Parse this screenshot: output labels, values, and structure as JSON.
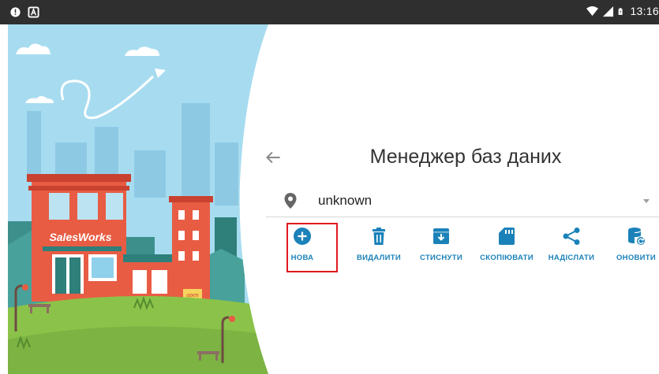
{
  "status_bar": {
    "left_icons": [
      "alert-icon",
      "a-icon"
    ],
    "right_icons": [
      "wifi-icon",
      "signal-icon",
      "battery-icon"
    ],
    "time": "13:16"
  },
  "illustration": {
    "store_sign": "SalesWorks",
    "small_sign": "open"
  },
  "header": {
    "back_icon": "arrow-back-icon",
    "title": "Менеджер баз даних"
  },
  "database_selector": {
    "icon": "location-pin-icon",
    "value": "unknown",
    "dropdown_icon": "dropdown-caret-icon"
  },
  "actions": [
    {
      "label": "НОВА",
      "icon": "add-circle-icon"
    },
    {
      "label": "ВИДАЛИТИ",
      "icon": "trash-icon"
    },
    {
      "label": "СТИСНУТИ",
      "icon": "archive-icon"
    },
    {
      "label": "СКОПІЮВАТИ",
      "icon": "sd-card-icon"
    },
    {
      "label": "НАДІСЛАТИ",
      "icon": "share-icon"
    },
    {
      "label": "ОНОВИТИ",
      "icon": "database-refresh-icon"
    }
  ],
  "colors": {
    "accent": "#1b82b9",
    "highlight_border": "#e0191f",
    "status_bar": "#2f2f2f",
    "sky": "#a7dcf0",
    "building": "#e85c44",
    "grass": "#8bc34a"
  }
}
